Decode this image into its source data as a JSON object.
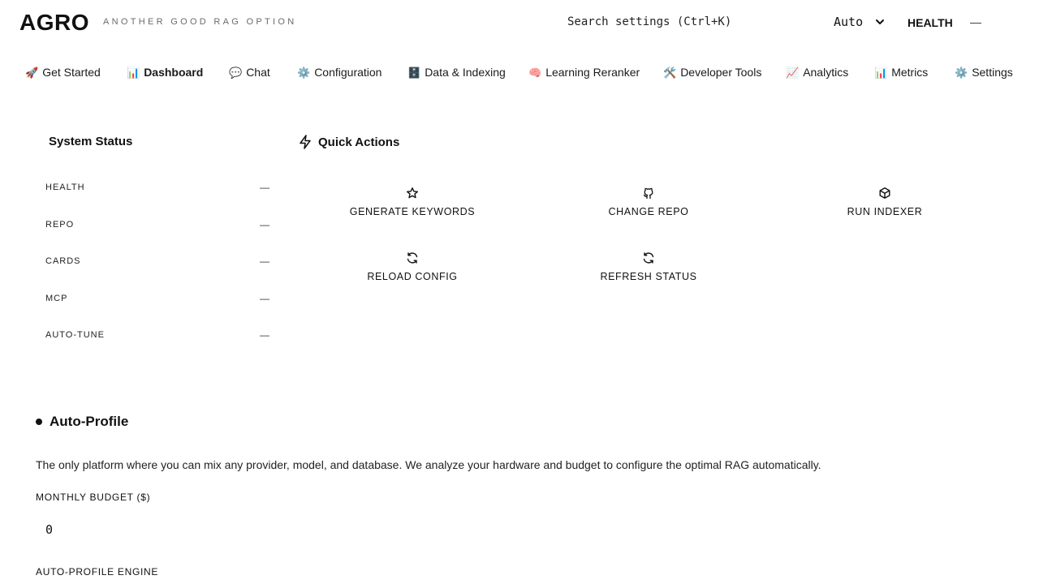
{
  "header": {
    "logo": "AGRO",
    "tagline": "ANOTHER GOOD RAG OPTION",
    "search_placeholder": "Search settings (Ctrl+K)",
    "theme_value": "Auto",
    "health_label": "HEALTH",
    "health_value": "—"
  },
  "tabs": [
    {
      "emoji": "🚀",
      "label": "Get Started",
      "icon": "rocket-icon"
    },
    {
      "emoji": "📊",
      "label": "Dashboard",
      "icon": "bar-chart-icon",
      "active": true
    },
    {
      "emoji": "💬",
      "label": "Chat",
      "icon": "speech-bubble-icon"
    },
    {
      "emoji": "⚙️",
      "label": "Configuration",
      "icon": "gear-icon"
    },
    {
      "emoji": "🗄️",
      "label": "Data & Indexing",
      "icon": "file-cabinet-icon"
    },
    {
      "emoji": "🧠",
      "label": "Learning Reranker",
      "icon": "brain-icon"
    },
    {
      "emoji": "🛠️",
      "label": "Developer Tools",
      "icon": "tools-icon"
    },
    {
      "emoji": "📈",
      "label": "Analytics",
      "icon": "chart-up-icon"
    },
    {
      "emoji": "📊",
      "label": "Metrics",
      "icon": "bar-chart-icon"
    },
    {
      "emoji": "⚙️",
      "label": "Settings",
      "icon": "gear-icon"
    }
  ],
  "system_status": {
    "title": "System Status",
    "rows": [
      {
        "label": "HEALTH",
        "value": "—"
      },
      {
        "label": "REPO",
        "value": "—"
      },
      {
        "label": "CARDS",
        "value": "—"
      },
      {
        "label": "MCP",
        "value": "—"
      },
      {
        "label": "AUTO-TUNE",
        "value": "—"
      }
    ]
  },
  "quick_actions": {
    "title": "Quick Actions",
    "icon": "lightning-icon",
    "actions": [
      {
        "label": "GENERATE KEYWORDS",
        "icon": "star-icon"
      },
      {
        "label": "CHANGE REPO",
        "icon": "github-icon"
      },
      {
        "label": "RUN INDEXER",
        "icon": "cube-icon"
      },
      {
        "label": "RELOAD CONFIG",
        "icon": "refresh-icon"
      },
      {
        "label": "REFRESH STATUS",
        "icon": "refresh-icon"
      }
    ]
  },
  "auto_profile": {
    "title": "Auto-Profile",
    "description": "The only platform where you can mix any provider, model, and database. We analyze your hardware and budget to configure the optimal RAG automatically.",
    "budget_label": "MONTHLY BUDGET ($)",
    "budget_value": "0",
    "engine_label": "AUTO-PROFILE ENGINE"
  }
}
